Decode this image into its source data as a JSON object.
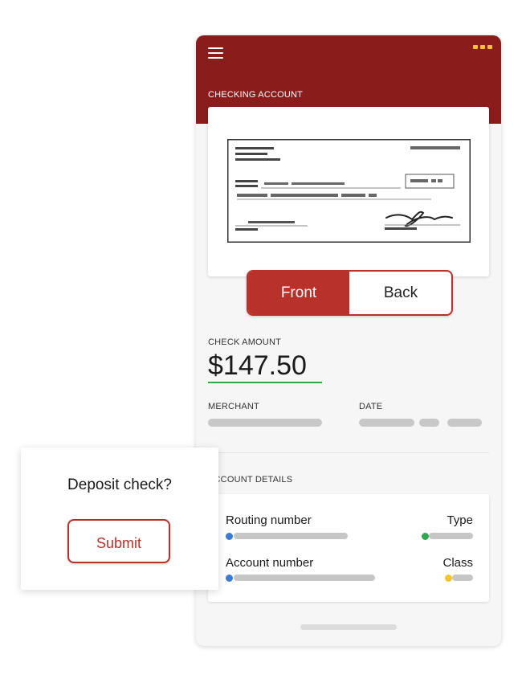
{
  "header": {
    "account_title": "CHECKING ACCOUNT"
  },
  "check_toggle": {
    "front_label": "Front",
    "back_label": "Back",
    "selected": "Front"
  },
  "check_info": {
    "amount_label": "CHECK AMOUNT",
    "amount_value": "$147.50",
    "merchant_label": "MERCHANT",
    "date_label": "DATE"
  },
  "account_details": {
    "title": "ACCOUNT DETAILS",
    "routing_label": "Routing number",
    "type_label": "Type",
    "account_label": "Account number",
    "class_label": "Class"
  },
  "deposit_dialog": {
    "question": "Deposit check?",
    "submit_label": "Submit"
  },
  "colors": {
    "header_bg": "#8b1c1c",
    "accent_red": "#b8312b",
    "menu_dots": "#f4c430",
    "amount_underline": "#2fa84f",
    "routing_dot": "#3a7bd5",
    "type_dot": "#2fa84f",
    "class_dot": "#f4c430"
  },
  "icons": [
    "menu-icon",
    "more-dots-icon",
    "check-image",
    "signature-icon"
  ]
}
